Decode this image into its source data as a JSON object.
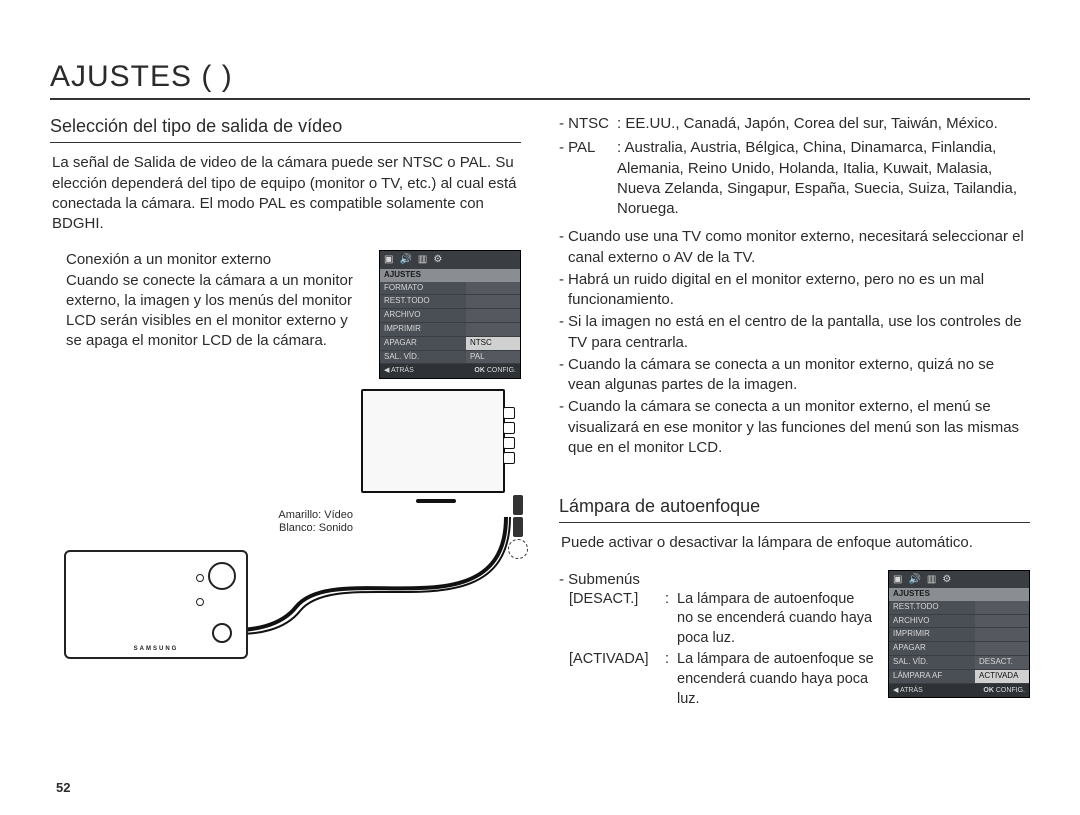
{
  "page_number": "52",
  "title": "AJUSTES (        )",
  "left": {
    "heading": "Selección del tipo de salida de vídeo",
    "intro": "La señal de Salida de video de la cámara puede ser NTSC o PAL. Su elección dependerá del tipo de equipo (monitor o TV, etc.) al cual está conectada la cámara. El modo PAL es compatible solamente con BDGHI.",
    "monitor_label": "Conexión a un monitor externo",
    "monitor_desc": "Cuando se conecte la cámara a un monitor externo, la imagen y los menús del monitor LCD serán visibles en el monitor externo y se apaga el monitor LCD de la cámara.",
    "lcd1": {
      "hdr": "AJUSTES",
      "items_left": [
        "FORMATO",
        "REST.TODO",
        "ARCHIVO",
        "IMPRIMIR",
        "APAGAR",
        "SAL. VÍD."
      ],
      "opt1": "NTSC",
      "opt2": "PAL",
      "foot_left_sym": "◀",
      "foot_left": "ATRÁS",
      "foot_ok": "OK",
      "foot_right": "CONFIG."
    },
    "diag_label1": "Amarillo: Vídeo",
    "diag_label2": "Blanco: Sonido",
    "camera_brand": "SAMSUNG"
  },
  "right": {
    "ntsc": {
      "k": "- NTSC",
      "v": ": EE.UU., Canadá, Japón, Corea del sur, Taiwán, México."
    },
    "pal": {
      "k": "- PAL",
      "v": ": Australia, Austria, Bélgica, China, Dinamarca, Finlandia, Alemania, Reino Unido, Holanda, Italia, Kuwait, Malasia, Nueva Zelanda, Singapur, España, Suecia, Suiza, Tailandia, Noruega."
    },
    "b1": "Cuando use una TV como monitor externo, necesitará seleccionar el canal externo o AV de la TV.",
    "b2": "Habrá un ruido digital en el monitor externo, pero no es un mal funcionamiento.",
    "b3": "Si la imagen no está en el centro de la pantalla, use los controles de TV para centrarla.",
    "b4": "Cuando la cámara se conecta a un monitor externo, quizá no se vean algunas partes de la imagen.",
    "b5": "Cuando la cámara se conecta a un monitor externo, el menú se visualizará en ese monitor y las funciones del menú son las mismas que en el monitor LCD.",
    "af_heading": "Lámpara de autoenfoque",
    "af_intro": "Puede activar o desactivar la lámpara de enfoque automático.",
    "af_sub": "- Submenús",
    "af_off_k": "[DESACT.]",
    "af_off_v": "La lámpara de autoenfoque no se encenderá cuando haya poca luz.",
    "af_on_k": "[ACTIVADA]",
    "af_on_v": "La lámpara de autoenfoque se encenderá cuando haya poca luz.",
    "lcd2": {
      "hdr": "AJUSTES",
      "items_left": [
        "REST.TODO",
        "ARCHIVO",
        "IMPRIMIR",
        "APAGAR",
        "SAL. VÍD.",
        "LÁMPARA AF"
      ],
      "opt1": "DESACT.",
      "opt2": "ACTIVADA",
      "foot_left_sym": "◀",
      "foot_left": "ATRÁS",
      "foot_ok": "OK",
      "foot_right": "CONFIG."
    }
  }
}
